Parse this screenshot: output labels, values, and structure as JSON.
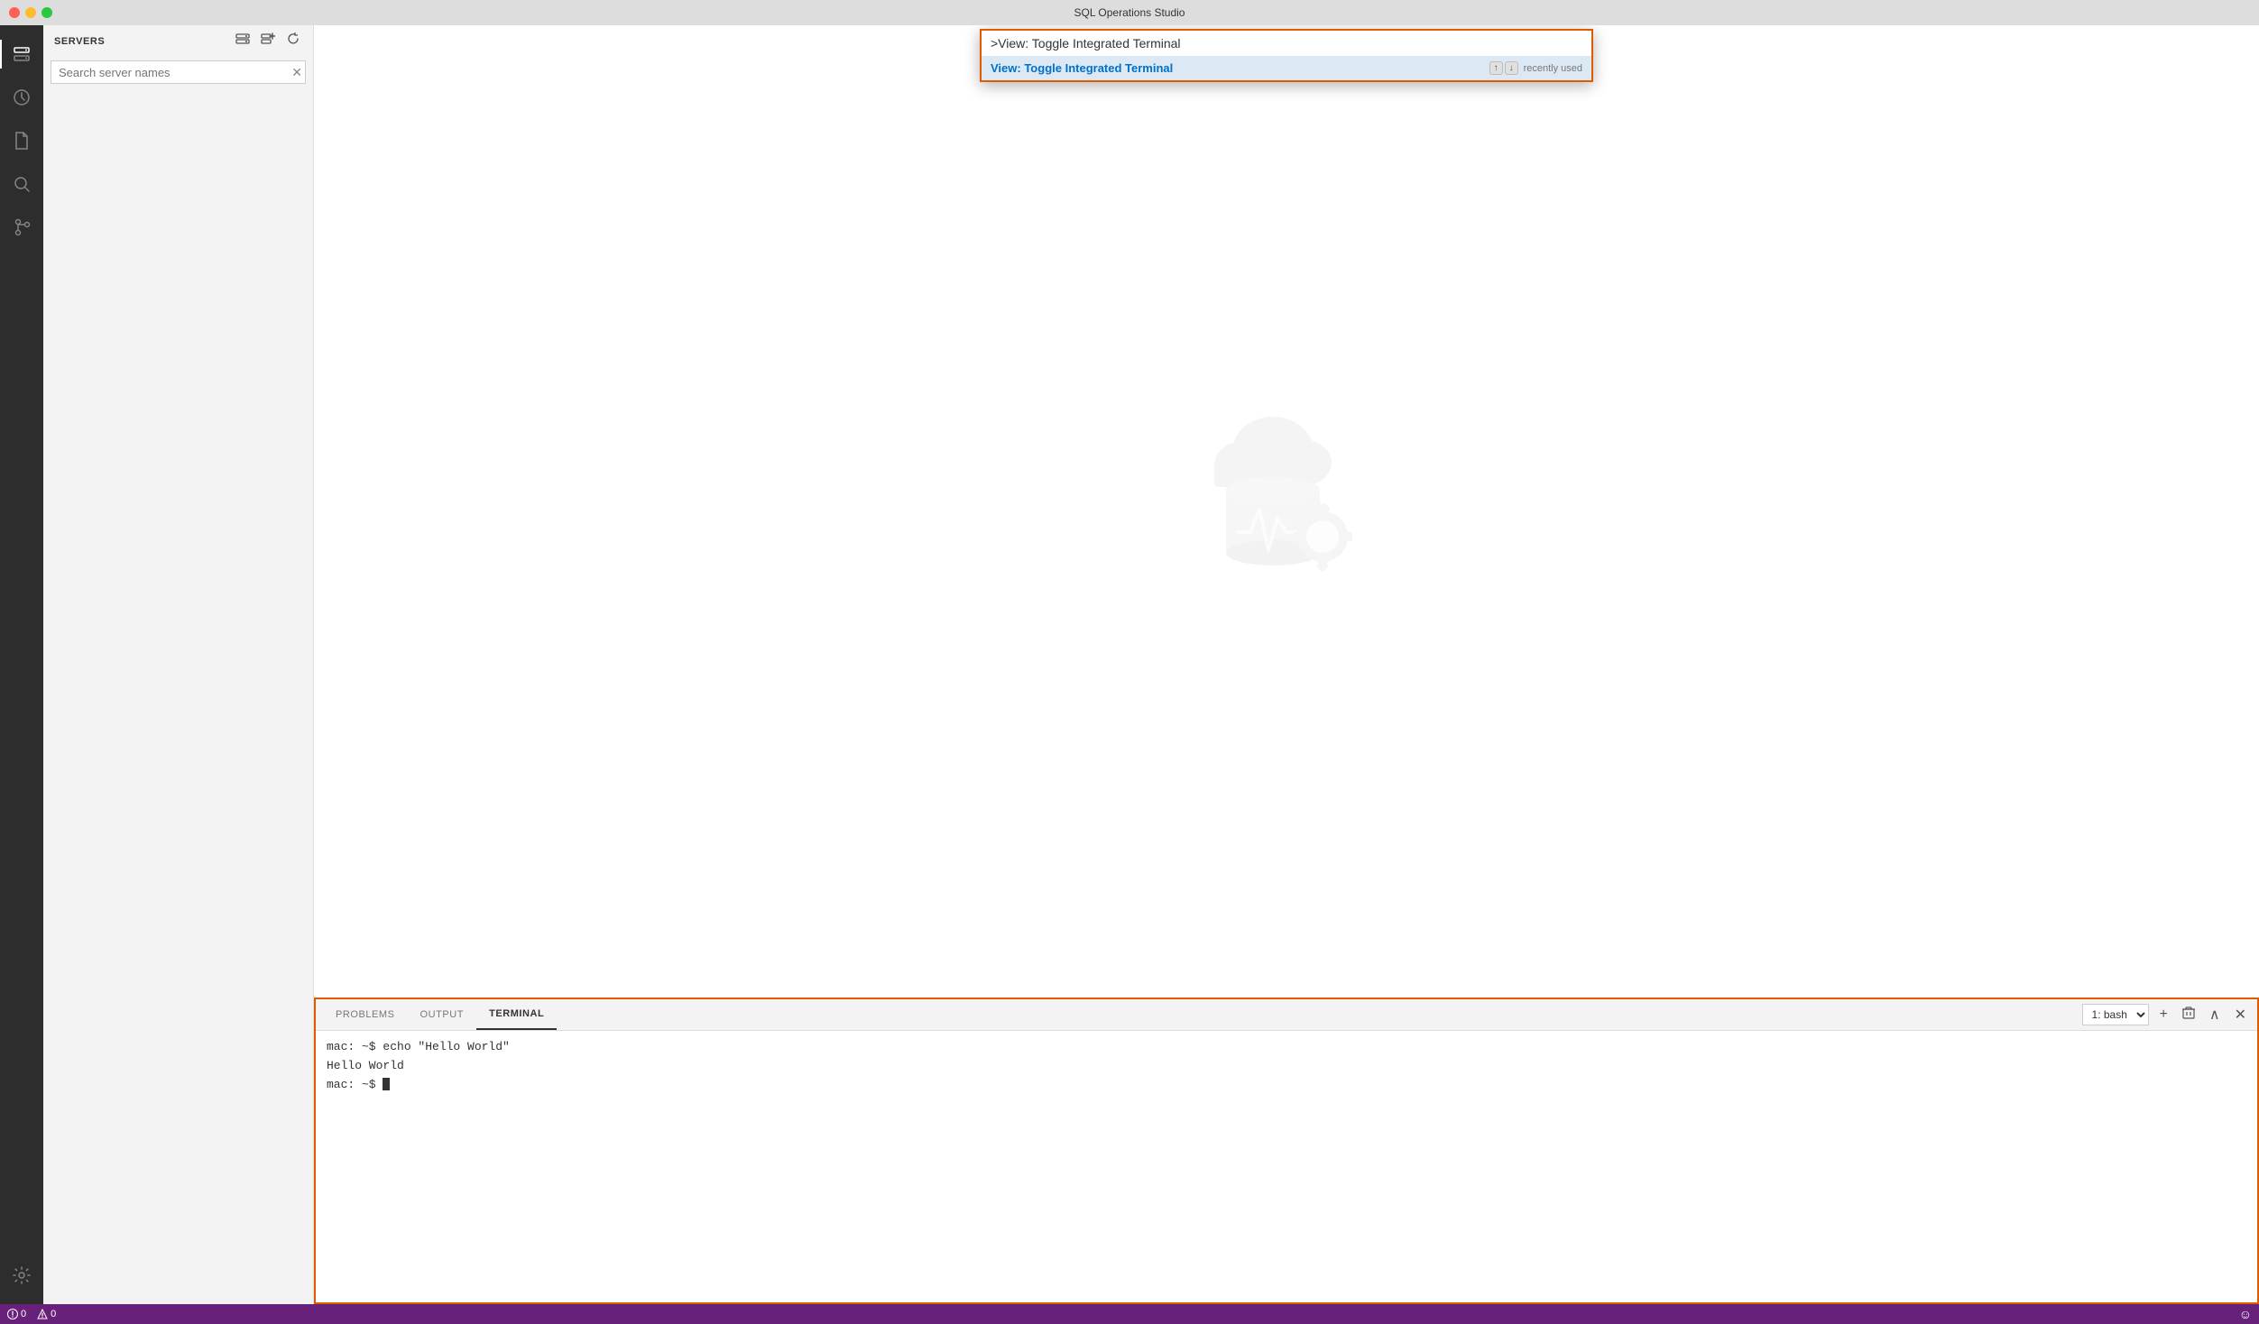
{
  "titlebar": {
    "title": "SQL Operations Studio",
    "buttons": {
      "close": "close",
      "minimize": "minimize",
      "maximize": "maximize"
    }
  },
  "activity_bar": {
    "icons": [
      {
        "name": "servers-icon",
        "symbol": "⬡",
        "active": true,
        "label": "Servers"
      },
      {
        "name": "history-icon",
        "symbol": "🕐",
        "active": false,
        "label": "History"
      },
      {
        "name": "new-file-icon",
        "symbol": "📄",
        "active": false,
        "label": "New File"
      },
      {
        "name": "search-icon",
        "symbol": "🔍",
        "active": false,
        "label": "Search"
      },
      {
        "name": "git-icon",
        "symbol": "⑂",
        "active": false,
        "label": "Source Control"
      }
    ],
    "bottom_icons": [
      {
        "name": "settings-icon",
        "symbol": "⚙",
        "label": "Settings"
      }
    ]
  },
  "sidebar": {
    "header": "SERVERS",
    "search_placeholder": "Search server names",
    "icons": [
      {
        "name": "new-connection-icon",
        "label": "New Connection"
      },
      {
        "name": "add-server-icon",
        "label": "Add Server"
      },
      {
        "name": "refresh-icon",
        "label": "Refresh"
      }
    ]
  },
  "command_palette": {
    "input_value": ">View: Toggle Integrated Terminal",
    "result": {
      "text": "View: Toggle Integrated Terminal",
      "kbd_up": "↑",
      "kbd_down": "↓",
      "badge": "recently used"
    }
  },
  "bottom_panel": {
    "tabs": [
      {
        "label": "PROBLEMS",
        "active": false
      },
      {
        "label": "OUTPUT",
        "active": false
      },
      {
        "label": "TERMINAL",
        "active": true
      }
    ],
    "terminal_selector": "1: bash",
    "terminal_lines": [
      "mac: ~$ echo \"Hello World\"",
      "Hello World",
      "mac: ~$ "
    ],
    "icons": {
      "add": "+",
      "delete": "🗑",
      "chevron_up": "∧",
      "close": "✕"
    }
  },
  "status_bar": {
    "errors": "0",
    "warnings": "0",
    "smiley": "☺"
  }
}
